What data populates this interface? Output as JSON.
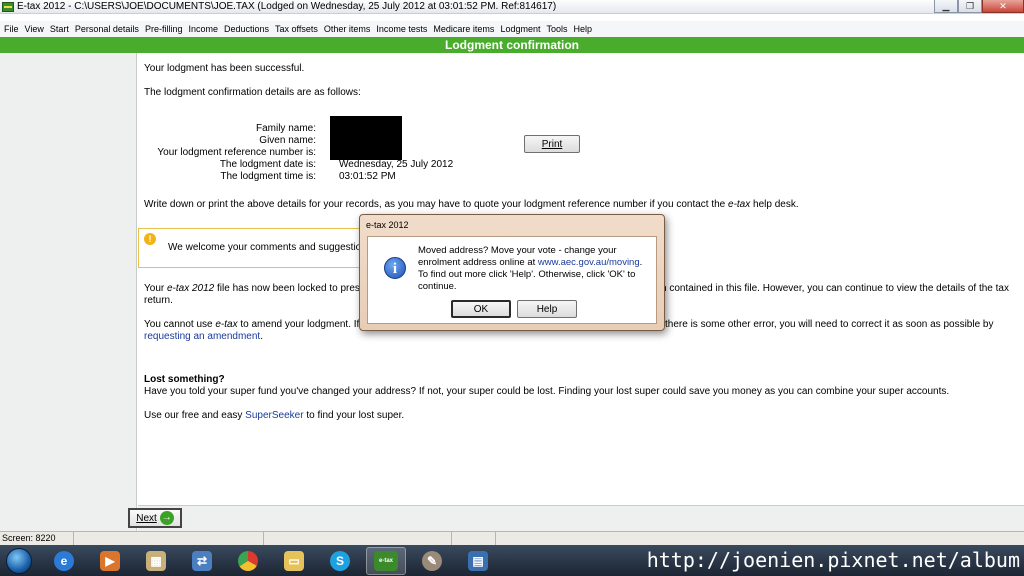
{
  "window": {
    "title": "E-tax 2012 - C:\\USERS\\JOE\\DOCUMENTS\\JOE.TAX (Lodged on Wednesday, 25 July 2012 at 03:01:52 PM.  Ref:814617)",
    "minimize_glyph": "▁",
    "restore_glyph": "❐",
    "close_glyph": "✕"
  },
  "menu": [
    "File",
    "View",
    "Start",
    "Personal details",
    "Pre-filling",
    "Income",
    "Deductions",
    "Tax offsets",
    "Other items",
    "Income tests",
    "Medicare items",
    "Lodgment",
    "Tools",
    "Help"
  ],
  "header": {
    "title": "Lodgment confirmation"
  },
  "main": {
    "success": "Your lodgment has been successful.",
    "details_intro": "The lodgment confirmation details are as follows:",
    "labels": {
      "family_name": "Family name:",
      "given_name": "Given name:",
      "reference": "Your lodgment reference number is:",
      "date": "The lodgment date is:",
      "time": "The lodgment time is:"
    },
    "values": {
      "date": "Wednesday, 25 July 2012",
      "time": "03:01:52 PM"
    },
    "print_label": "Print",
    "write_down": "Write down or print the above details for your records, as you may have to quote your lodgment reference number if you contact the ",
    "write_down_em": "e-tax",
    "write_down_end": " help desk.",
    "welcome": "We welcome your comments and suggestio",
    "locked_a": "Your ",
    "locked_em": "e-tax 2012",
    "locked_b": " file has now been locked to prese",
    "locked_c": "n contained in this file. However, you can continue to view the details of the tax",
    "locked_d": "return.",
    "amend_a": "You cannot use ",
    "amend_em": "e-tax",
    "amend_b": " to amend your lodgment. If y",
    "amend_c": "there is some other error, you will need to correct it as soon as possible by",
    "amend_link": "requesting an amendment",
    "amend_end": ".",
    "lost_heading": "Lost something?",
    "lost_text": "Have you told your super fund you've changed your address? If not, your super could be lost. Finding your lost super could save you money as you can combine your super accounts.",
    "seeker_a": "Use our free and easy ",
    "seeker_link": "SuperSeeker",
    "seeker_b": " to find your lost super."
  },
  "next_label": "Next",
  "status": {
    "screen": "Screen: 8220"
  },
  "dialog": {
    "title": "e-tax 2012",
    "line1": "Moved address? Move your vote - change your",
    "line2a": "enrolment address online at ",
    "line2_link": "www.aec.gov.au/moving",
    "line2b": ".",
    "line3": "To find out more click 'Help'. Otherwise, click 'OK' to",
    "line4": "continue.",
    "ok_label": "OK",
    "help_label": "Help"
  },
  "watermark": "http://joenien.pixnet.net/album",
  "taskbar": {
    "items": [
      "ie-icon",
      "media-player-icon",
      "file-explorer-icon",
      "network-icon",
      "chrome-icon",
      "folder-icon",
      "skype-icon",
      "etax-icon",
      "paint-icon",
      "book-icon"
    ],
    "skype_glyph": "S",
    "etax_glyph": "e-tax"
  },
  "colors": {
    "accent_green": "#4aac2c",
    "link_blue": "#1a3a9c"
  }
}
